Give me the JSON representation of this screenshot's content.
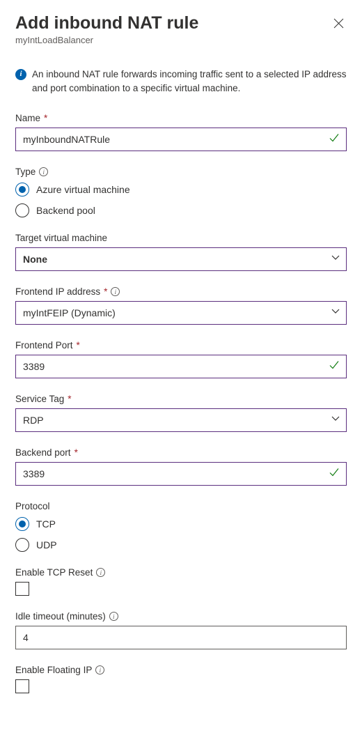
{
  "header": {
    "title": "Add inbound NAT rule",
    "subtitle": "myIntLoadBalancer"
  },
  "info_text": "An inbound NAT rule forwards incoming traffic sent to a selected IP address and port combination to a specific virtual machine.",
  "fields": {
    "name": {
      "label": "Name",
      "value": "myInboundNATRule"
    },
    "type": {
      "label": "Type",
      "options": {
        "vm": "Azure virtual machine",
        "pool": "Backend pool"
      },
      "selected": "vm"
    },
    "target_vm": {
      "label": "Target virtual machine",
      "value": "None"
    },
    "frontend_ip": {
      "label": "Frontend IP address",
      "value": "myIntFEIP (Dynamic)"
    },
    "frontend_port": {
      "label": "Frontend Port",
      "value": "3389"
    },
    "service_tag": {
      "label": "Service Tag",
      "value": "RDP"
    },
    "backend_port": {
      "label": "Backend port",
      "value": "3389"
    },
    "protocol": {
      "label": "Protocol",
      "options": {
        "tcp": "TCP",
        "udp": "UDP"
      },
      "selected": "tcp"
    },
    "tcp_reset": {
      "label": "Enable TCP Reset",
      "checked": false
    },
    "idle_timeout": {
      "label": "Idle timeout (minutes)",
      "value": "4"
    },
    "floating_ip": {
      "label": "Enable Floating IP",
      "checked": false
    }
  }
}
